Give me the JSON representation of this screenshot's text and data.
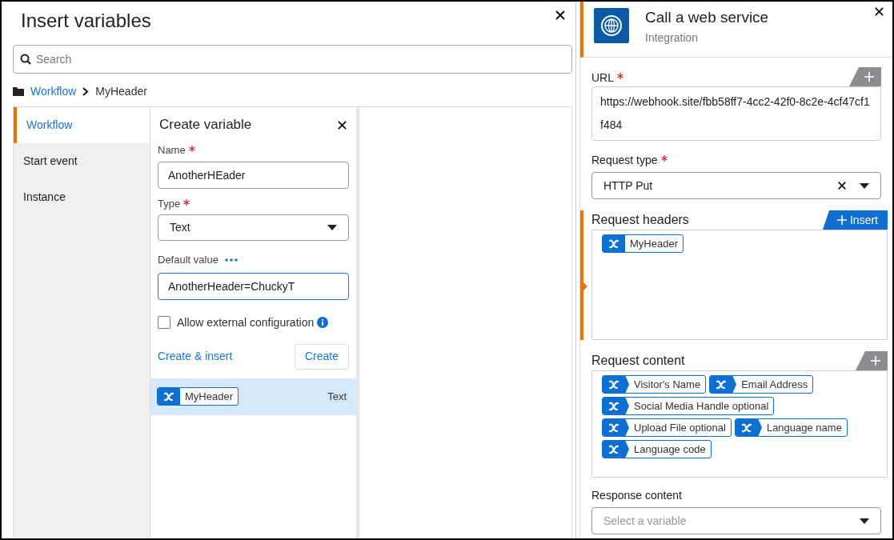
{
  "insert_panel": {
    "title": "Insert variables",
    "search": {
      "placeholder": "Search"
    },
    "breadcrumb": [
      {
        "label": "Workflow",
        "kind": "link"
      },
      {
        "label": "MyHeader",
        "kind": "current"
      }
    ],
    "tabs": [
      {
        "label": "Workflow",
        "selected": true
      },
      {
        "label": "Start event",
        "selected": false
      },
      {
        "label": "Instance",
        "selected": false
      }
    ],
    "create_variable": {
      "title": "Create variable",
      "name": {
        "label": "Name",
        "required": true,
        "value": "AnotherHEader"
      },
      "type": {
        "label": "Type",
        "required": true,
        "value": "Text"
      },
      "default_value": {
        "label": "Default value",
        "value": "AnotherHeader=ChuckyT",
        "focused": true
      },
      "external": {
        "label": "Allow external configuration",
        "checked": false
      },
      "create_insert": "Create & insert",
      "create": "Create"
    },
    "variables": [
      {
        "name": "MyHeader",
        "type": "Text",
        "selected": true
      }
    ]
  },
  "service_panel": {
    "title": "Call a web service",
    "subtitle": "Integration",
    "url": {
      "label": "URL",
      "required": true,
      "value": "https://webhook.site/fbb58ff7-4cc2-42f0-8c2e-4cf47cf1f484"
    },
    "request_type": {
      "label": "Request type",
      "required": true,
      "value": "HTTP Put"
    },
    "request_headers": {
      "label": "Request headers",
      "insert": "Insert",
      "active": true,
      "tokens": [
        "MyHeader"
      ]
    },
    "request_content": {
      "label": "Request content",
      "active": false,
      "tokens": [
        "Visitor's Name",
        "Email Address",
        "Social Media Handle optional",
        "Upload File optional",
        "Language name",
        "Language code"
      ]
    },
    "response_content": {
      "label": "Response content",
      "placeholder": "Select a variable"
    }
  }
}
